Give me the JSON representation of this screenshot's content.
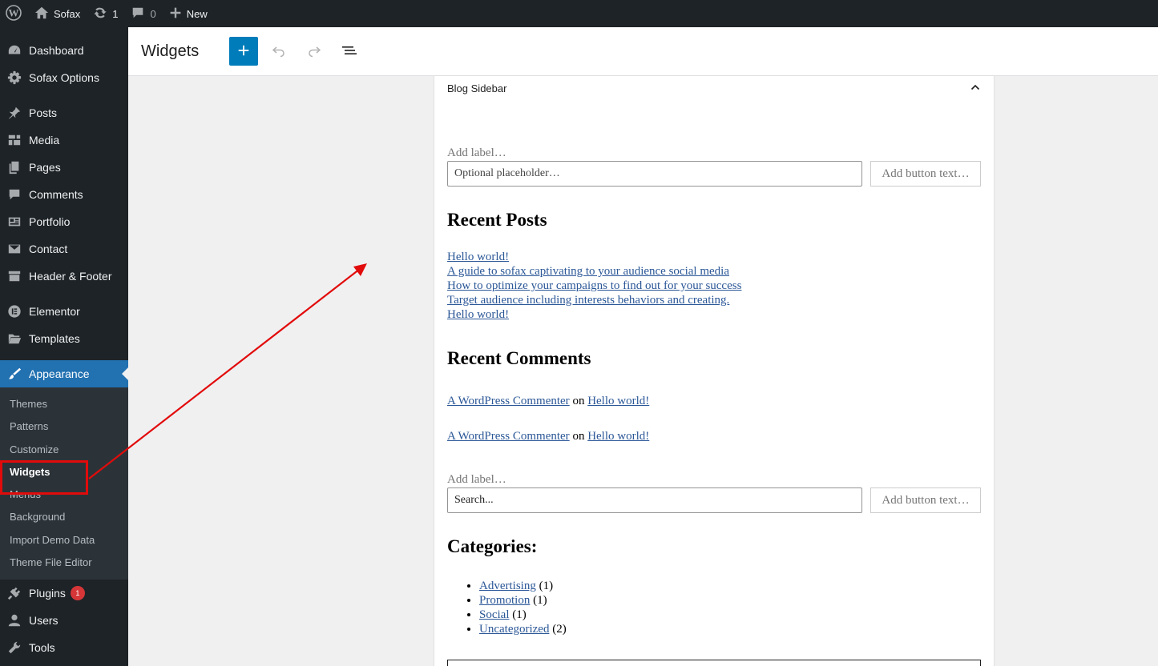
{
  "adminbar": {
    "site_name": "Sofax",
    "updates_count": "1",
    "comments_count": "0",
    "new_label": "New"
  },
  "sidebar": {
    "items": [
      {
        "label": "Dashboard",
        "icon": "dashboard-icon"
      },
      {
        "label": "Sofax Options",
        "icon": "gear-icon"
      },
      {
        "label": "Posts",
        "icon": "pin-icon"
      },
      {
        "label": "Media",
        "icon": "media-icon"
      },
      {
        "label": "Pages",
        "icon": "pages-icon"
      },
      {
        "label": "Comments",
        "icon": "comment-icon"
      },
      {
        "label": "Portfolio",
        "icon": "portfolio-icon"
      },
      {
        "label": "Contact",
        "icon": "envelope-icon"
      },
      {
        "label": "Header & Footer",
        "icon": "archive-icon"
      },
      {
        "label": "Elementor",
        "icon": "elementor-icon"
      },
      {
        "label": "Templates",
        "icon": "folder-icon"
      },
      {
        "label": "Appearance",
        "icon": "paintbrush-icon"
      },
      {
        "label": "Plugins",
        "icon": "plugin-icon",
        "badge": "1"
      },
      {
        "label": "Users",
        "icon": "user-icon"
      },
      {
        "label": "Tools",
        "icon": "wrench-icon"
      }
    ],
    "appearance_sub": [
      "Themes",
      "Patterns",
      "Customize",
      "Widgets",
      "Menus",
      "Background",
      "Import Demo Data",
      "Theme File Editor"
    ]
  },
  "toolbar": {
    "title": "Widgets"
  },
  "editor": {
    "area_title": "Blog Sidebar",
    "search1": {
      "label": "Add label…",
      "placeholder": "Optional placeholder…",
      "button": "Add button text…"
    },
    "recent_posts": {
      "title": "Recent Posts",
      "items": [
        "Hello world!",
        "A guide to sofax captivating to your audience social media",
        "How to optimize your campaigns to find out for your success",
        "Target audience including interests behaviors and creating.",
        "Hello world!"
      ]
    },
    "recent_comments": {
      "title": "Recent Comments",
      "items": [
        {
          "author": "A WordPress Commenter",
          "on": "on",
          "post": "Hello world!"
        },
        {
          "author": "A WordPress Commenter",
          "on": "on",
          "post": "Hello world!"
        }
      ]
    },
    "search2": {
      "label": "Add label…",
      "placeholder": "Search...",
      "button": "Add button text…"
    },
    "categories": {
      "title": "Categories:",
      "items": [
        {
          "name": "Advertising",
          "count": "(1)"
        },
        {
          "name": "Promotion",
          "count": "(1)"
        },
        {
          "name": "Social",
          "count": "(1)"
        },
        {
          "name": "Uncategorized",
          "count": "(2)"
        }
      ]
    }
  },
  "colors": {
    "admin_dark": "#1d2327",
    "accent": "#2271b1",
    "annotation": "#e20b0b"
  }
}
